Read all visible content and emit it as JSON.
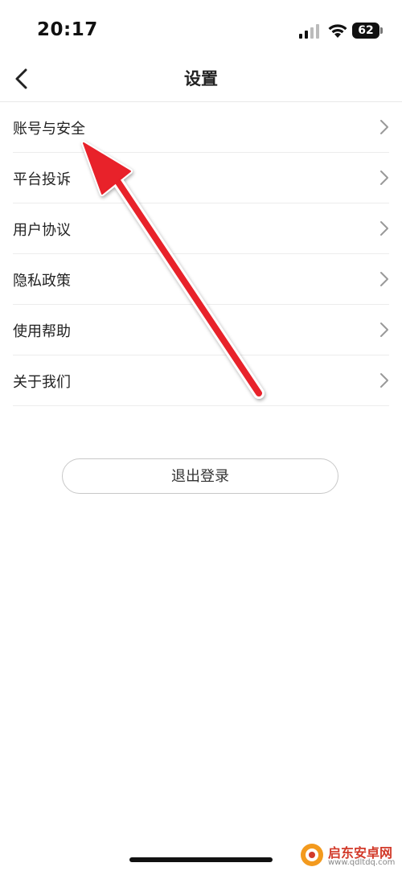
{
  "status_bar": {
    "time": "20:17",
    "battery": "62",
    "icons": [
      "signal-icon",
      "wifi-icon",
      "battery-icon"
    ]
  },
  "header": {
    "title": "设置",
    "back_icon": "chevron-left-icon"
  },
  "menu": {
    "items": [
      {
        "label": "账号与安全"
      },
      {
        "label": "平台投诉"
      },
      {
        "label": "用户协议"
      },
      {
        "label": "隐私政策"
      },
      {
        "label": "使用帮助"
      },
      {
        "label": "关于我们"
      }
    ]
  },
  "logout": {
    "label": "退出登录"
  },
  "annotation": {
    "arrow_color": "#e8202a",
    "points_to": "账号与安全"
  },
  "watermark": {
    "name": "启东安卓网",
    "url": "www.qdltdq.com"
  },
  "colors": {
    "text": "#222222",
    "divider": "#ececec",
    "button_border": "#c8c8c8",
    "accent_red": "#e8202a"
  }
}
